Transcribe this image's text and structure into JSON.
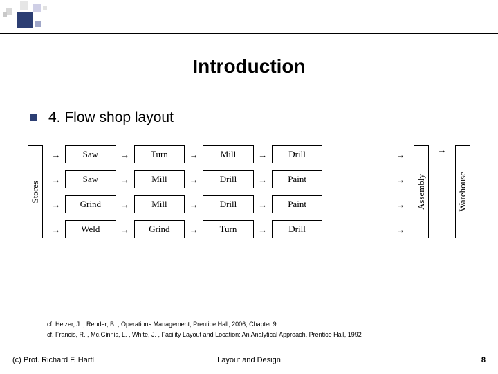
{
  "title": "Introduction",
  "bullet": "4. Flow shop layout",
  "diagram": {
    "stores_label": "Stores",
    "assembly_label": "Assembly",
    "warehouse_label": "Warehouse",
    "rows": [
      {
        "cells": [
          "Saw",
          "Turn",
          "Mill",
          "Drill",
          ""
        ]
      },
      {
        "cells": [
          "Saw",
          "Mill",
          "Drill",
          "Paint",
          ""
        ]
      },
      {
        "cells": [
          "Grind",
          "Mill",
          "Drill",
          "Paint",
          ""
        ]
      },
      {
        "cells": [
          "Weld",
          "Grind",
          "Turn",
          "Drill",
          ""
        ]
      }
    ]
  },
  "refs": [
    "cf. Heizer, J. , Render, B. , Operations Management, Prentice Hall, 2006, Chapter 9",
    "cf. Francis, R. , Mc.Ginnis, L. , White, J. , Facility Layout and Location: An Analytical Approach, Prentice Hall, 1992"
  ],
  "footer": {
    "left": "(c) Prof. Richard F. Hartl",
    "center": "Layout and Design",
    "page": "8"
  }
}
